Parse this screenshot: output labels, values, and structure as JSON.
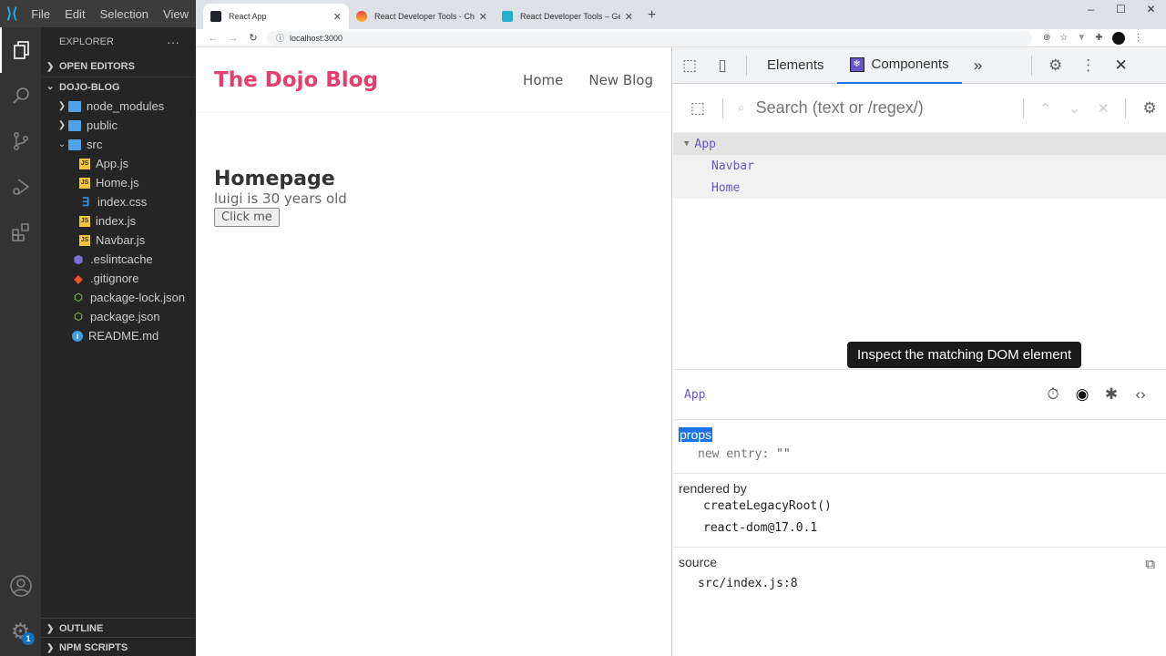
{
  "vscode": {
    "menu": [
      "File",
      "Edit",
      "Selection",
      "View"
    ],
    "explorer_title": "EXPLORER",
    "more_label": "···",
    "open_editors": "OPEN EDITORS",
    "project": "DOJO-BLOG",
    "tree": [
      {
        "name": "node_modules",
        "type": "folder",
        "expanded": false
      },
      {
        "name": "public",
        "type": "folder",
        "expanded": false
      },
      {
        "name": "src",
        "type": "folder",
        "expanded": true
      },
      {
        "name": "App.js",
        "type": "js"
      },
      {
        "name": "Home.js",
        "type": "js"
      },
      {
        "name": "index.css",
        "type": "css"
      },
      {
        "name": "index.js",
        "type": "js"
      },
      {
        "name": "Navbar.js",
        "type": "js"
      },
      {
        "name": ".eslintcache",
        "type": "eslint"
      },
      {
        "name": ".gitignore",
        "type": "git"
      },
      {
        "name": "package-lock.json",
        "type": "npm"
      },
      {
        "name": "package.json",
        "type": "npm"
      },
      {
        "name": "README.md",
        "type": "info"
      }
    ],
    "outline": "OUTLINE",
    "npm_scripts": "NPM SCRIPTS",
    "settings_badge": "1"
  },
  "browser": {
    "tabs": [
      {
        "title": "React App",
        "active": true
      },
      {
        "title": "React Developer Tools - Chrome",
        "active": false
      },
      {
        "title": "React Developer Tools – Get this",
        "active": false
      }
    ],
    "new_tab": "+",
    "url": "localhost:3000",
    "window_controls": [
      "–",
      "☐",
      "✕"
    ]
  },
  "page": {
    "brand": "The Dojo Blog",
    "links": [
      "Home",
      "New Blog"
    ],
    "heading": "Homepage",
    "text": "luigi is 30 years old",
    "button": "Click me"
  },
  "devtools": {
    "tabs": [
      "Elements",
      "Components"
    ],
    "active_tab": "Components",
    "more": "»",
    "search_placeholder": "Search (text or /regex/)",
    "tree": [
      {
        "name": "App",
        "depth": 0,
        "expanded": true
      },
      {
        "name": "Navbar",
        "depth": 1
      },
      {
        "name": "Home",
        "depth": 1
      }
    ],
    "tooltip": "Inspect the matching DOM element",
    "selected_component": "App",
    "props_title": "props",
    "props": [
      {
        "key": "new entry",
        "value": "\"\""
      }
    ],
    "rendered_by_title": "rendered by",
    "rendered_by": [
      "createLegacyRoot()",
      "react-dom@17.0.1"
    ],
    "source_title": "source",
    "source": "src/index.js:8"
  }
}
